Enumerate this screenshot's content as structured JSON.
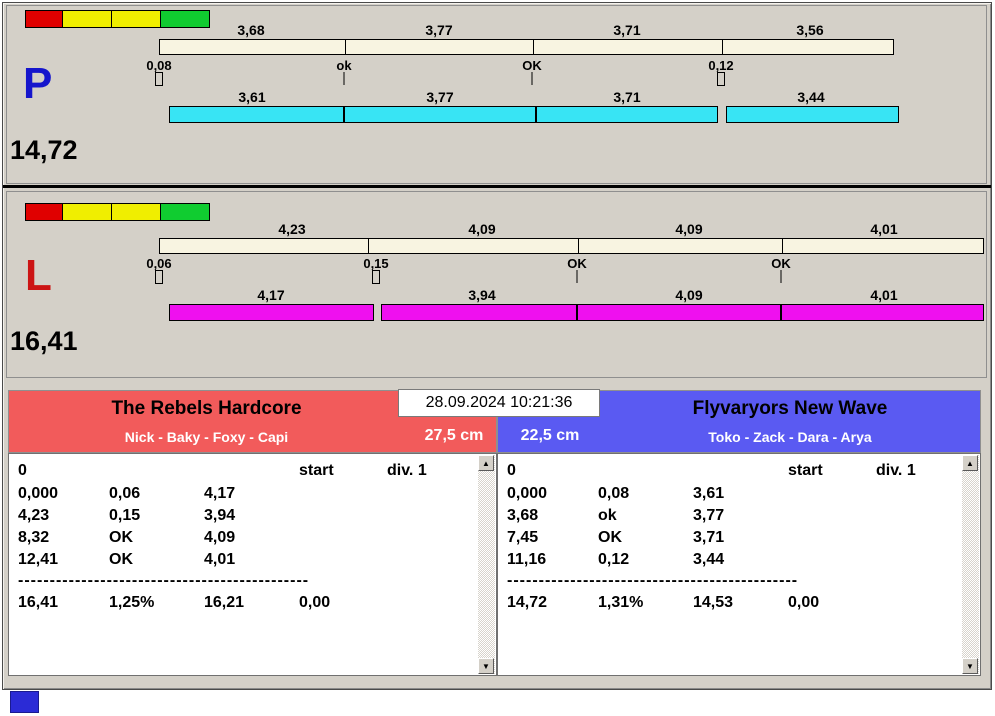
{
  "indicator_colors": [
    "#e00000",
    "#f0ee00",
    "#f0ee00",
    "#10cc30"
  ],
  "lanes": [
    {
      "letter": "P",
      "letter_color": "#1515cc",
      "total": "14,72",
      "bar_color": "#38e4f4",
      "ruler_values": [
        "3,68",
        "3,77",
        "3,71",
        "3,56"
      ],
      "tick_labels": [
        "0,08",
        "ok",
        "OK",
        "0,12"
      ],
      "bar_values": [
        "3,61",
        "3,77",
        "3,71",
        "3,44"
      ]
    },
    {
      "letter": "L",
      "letter_color": "#cc1414",
      "total": "16,41",
      "bar_color": "#ef10ef",
      "ruler_values": [
        "4,23",
        "4,09",
        "4,09",
        "4,01"
      ],
      "tick_labels": [
        "0,06",
        "0,15",
        "OK",
        "OK"
      ],
      "bar_values": [
        "4,17",
        "3,94",
        "4,09",
        "4,01"
      ]
    }
  ],
  "scoreboard": {
    "datetime": "28.09.2024 10:21:36",
    "left": {
      "team": "The Rebels Hardcore",
      "players": "Nick - Baky - Foxy - Capi",
      "distance": "27,5 cm",
      "header_color": "#f25b5b",
      "head": {
        "zero": "0",
        "start": "start",
        "division": "div. 1"
      },
      "rows": [
        [
          "0,000",
          "0,06",
          "4,17"
        ],
        [
          "4,23",
          "0,15",
          "3,94"
        ],
        [
          "8,32",
          "OK",
          "4,09"
        ],
        [
          "12,41",
          "OK",
          "4,01"
        ]
      ],
      "separator": "--------------------------------------------------",
      "totals": [
        "16,41",
        "1,25%",
        "16,21",
        "0,00"
      ]
    },
    "right": {
      "team": "Flyvaryors New Wave",
      "players": "Toko - Zack - Dara - Arya",
      "distance": "22,5 cm",
      "header_color": "#5a5af2",
      "head": {
        "zero": "0",
        "start": "start",
        "division": "div. 1"
      },
      "rows": [
        [
          "0,000",
          "0,08",
          "3,61"
        ],
        [
          "3,68",
          "ok",
          "3,77"
        ],
        [
          "7,45",
          "OK",
          "3,71"
        ],
        [
          "11,16",
          "0,12",
          "3,44"
        ]
      ],
      "separator": "--------------------------------------------------",
      "totals": [
        "14,72",
        "1,31%",
        "14,53",
        "0,00"
      ]
    }
  },
  "icons": {
    "scroll_up": "▲",
    "scroll_down": "▼"
  }
}
